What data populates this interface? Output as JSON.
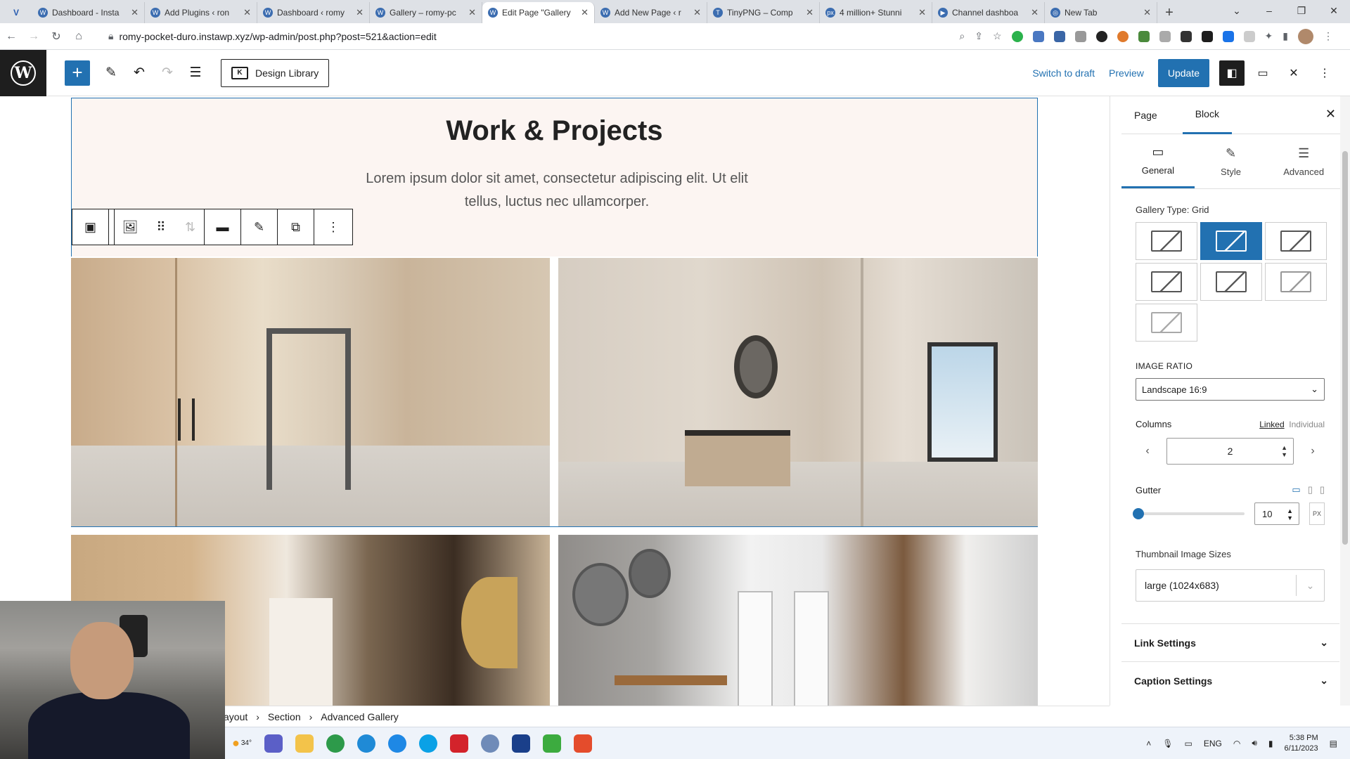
{
  "browser": {
    "tabs": [
      {
        "title": "Dashboard - Insta",
        "fav": "W"
      },
      {
        "title": "Add Plugins ‹ ron",
        "fav": "W"
      },
      {
        "title": "Dashboard ‹ romy",
        "fav": "W"
      },
      {
        "title": "Gallery – romy-pc",
        "fav": "W"
      },
      {
        "title": "Edit Page \"Gallery",
        "fav": "W",
        "active": true
      },
      {
        "title": "Add New Page ‹ r",
        "fav": "W"
      },
      {
        "title": "TinyPNG – Comp",
        "fav": "T"
      },
      {
        "title": "4 million+ Stunni",
        "fav": "px"
      },
      {
        "title": "Channel dashboa",
        "fav": "▶"
      },
      {
        "title": "New Tab",
        "fav": "◎"
      }
    ],
    "url": "romy-pocket-duro.instawp.xyz/wp-admin/post.php?post=521&action=edit"
  },
  "editor": {
    "design_library": "Design Library",
    "switch_to_draft": "Switch to draft",
    "preview": "Preview",
    "update": "Update"
  },
  "content": {
    "heading": "Work & Projects",
    "lead": "Lorem ipsum dolor sit amet, consectetur adipiscing elit. Ut elit tellus, luctus nec ullamcorper."
  },
  "breadcrumb": [
    "ayout",
    "Section",
    "Advanced Gallery"
  ],
  "sidebar": {
    "tab_page": "Page",
    "tab_block": "Block",
    "subtabs": [
      "General",
      "Style",
      "Advanced"
    ],
    "gallery_type_label": "Gallery Type: Grid",
    "image_ratio_label": "IMAGE RATIO",
    "image_ratio_value": "Landscape 16:9",
    "columns_label": "Columns",
    "linked": "Linked",
    "individual": "Individual",
    "columns_value": "2",
    "gutter_label": "Gutter",
    "gutter_value": "10",
    "gutter_unit": "PX",
    "thumb_label": "Thumbnail Image Sizes",
    "thumb_value": "large (1024x683)",
    "link_settings": "Link Settings",
    "caption_settings": "Caption Settings"
  },
  "taskbar": {
    "weather": "34°",
    "lang": "ENG",
    "time": "5:38 PM",
    "date": "6/11/2023"
  }
}
